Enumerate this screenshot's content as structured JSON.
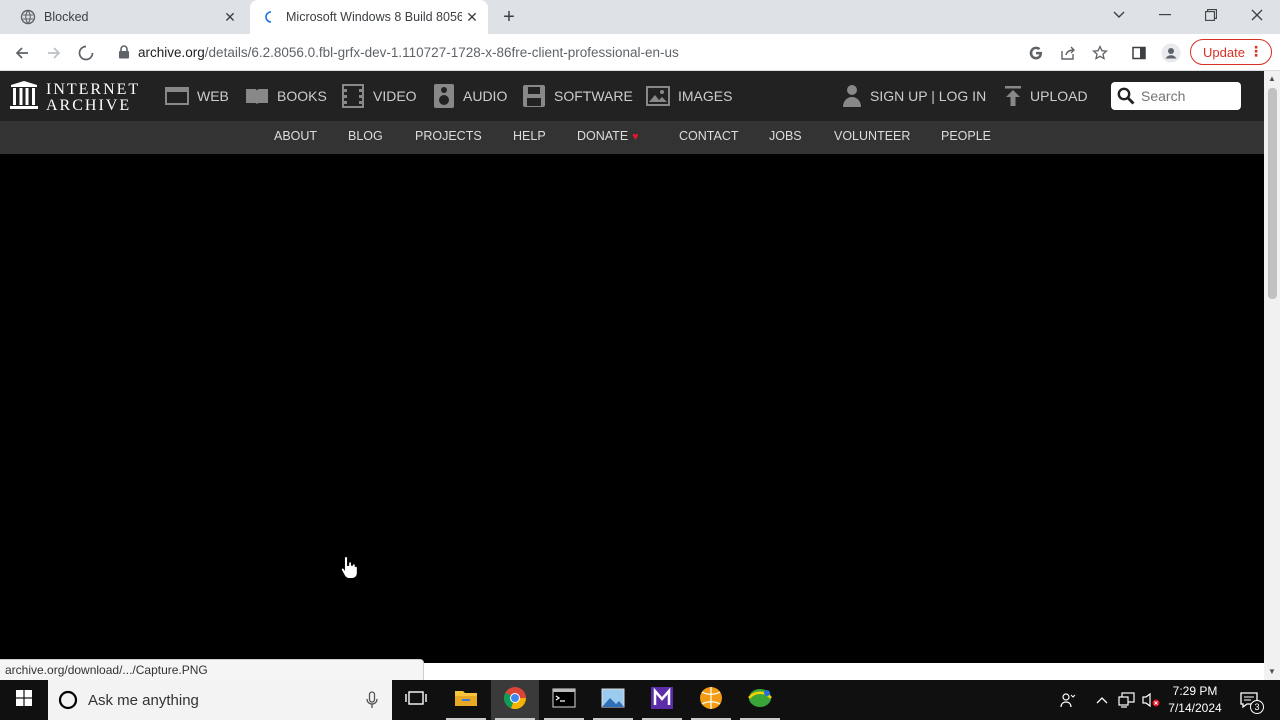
{
  "browser": {
    "tabs": [
      {
        "title": "Blocked",
        "active": false
      },
      {
        "title": "Microsoft Windows 8 Build 8056",
        "active": true
      }
    ],
    "new_tab_symbol": "+",
    "url_host": "archive.org",
    "url_path": "/details/6.2.8056.0.fbl-grfx-dev-1.110727-1728-x-86fre-client-professional-en-us",
    "update_label": "Update",
    "status_text": "archive.org/download/.../Capture.PNG"
  },
  "ia": {
    "logo_line1": "INTERNET",
    "logo_line2": "ARCHIVE",
    "nav": [
      {
        "label": "WEB",
        "icon": "web-icon"
      },
      {
        "label": "BOOKS",
        "icon": "books-icon"
      },
      {
        "label": "VIDEO",
        "icon": "video-icon"
      },
      {
        "label": "AUDIO",
        "icon": "audio-icon"
      },
      {
        "label": "SOFTWARE",
        "icon": "software-icon"
      },
      {
        "label": "IMAGES",
        "icon": "images-icon"
      }
    ],
    "signin_label": "SIGN UP | LOG IN",
    "upload_label": "UPLOAD",
    "search_placeholder": "Search",
    "subnav": [
      "ABOUT",
      "BLOG",
      "PROJECTS",
      "HELP",
      "DONATE",
      "CONTACT",
      "JOBS",
      "VOLUNTEER",
      "PEOPLE"
    ]
  },
  "taskbar": {
    "search_placeholder": "Ask me anything",
    "time": "7:29 PM",
    "date": "7/14/2024",
    "notification_count": "3"
  },
  "colors": {
    "ia_header": "#222222",
    "ia_subnav": "#333333",
    "update_red": "#d93025",
    "donate_heart": "#e0192d"
  }
}
